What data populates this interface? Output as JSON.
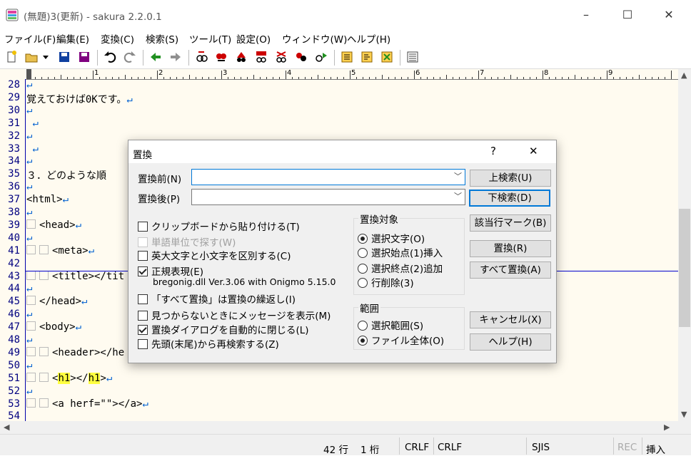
{
  "window": {
    "title": "(無題)3(更新) - sakura 2.2.0.1",
    "minimize": "–",
    "maximize": "☐",
    "close": "✕"
  },
  "menu": [
    "ファイル(F)",
    "編集(E)",
    "変換(C)",
    "検索(S)",
    "ツール(T)",
    "設定(O)",
    "ウィンドウ(W)",
    "ヘルプ(H)"
  ],
  "toolbar_icons": [
    "new-file-icon",
    "open-folder-icon",
    "dropdown-icon",
    "save-icon",
    "save-all-icon",
    "undo-icon",
    "redo-icon",
    "jump-back-icon",
    "jump-forward-icon",
    "search-prev-icon",
    "search-next-icon",
    "search-mark-icon",
    "replace-icon",
    "clear-mark-icon",
    "grep-icon",
    "compare-icon",
    "outline-icon",
    "function-list-icon",
    "bookmark-icon",
    "settings-icon"
  ],
  "ruler": {
    "marks": [
      "1",
      "2",
      "3",
      "4",
      "5",
      "6",
      "7",
      "8",
      "9"
    ]
  },
  "editor": {
    "lines": [
      {
        "n": "28",
        "text": "",
        "ret": "↵"
      },
      {
        "n": "29",
        "text": "覚えておけば0Kです。",
        "ret": "↵"
      },
      {
        "n": "30",
        "text": "",
        "ret": "↵"
      },
      {
        "n": "31",
        "text": " ",
        "ret": "↵"
      },
      {
        "n": "32",
        "text": "",
        "ret": "↵"
      },
      {
        "n": "33",
        "text": " ",
        "ret": "↵"
      },
      {
        "n": "34",
        "text": "",
        "ret": "↵"
      },
      {
        "n": "35",
        "text": "３．どのような順",
        "ret": ""
      },
      {
        "n": "36",
        "text": "",
        "ret": "↵"
      },
      {
        "n": "37",
        "text": "<html>",
        "ret": "↵"
      },
      {
        "n": "38",
        "text": "",
        "ret": "↵"
      },
      {
        "n": "39",
        "text": "<head>",
        "tabs": 1,
        "ret": "↵"
      },
      {
        "n": "40",
        "text": "",
        "ret": "↵"
      },
      {
        "n": "41",
        "text": "<meta>",
        "tabs": 2,
        "ret": "↵"
      },
      {
        "n": "42",
        "text": "",
        "ret": ""
      },
      {
        "n": "43",
        "text": "<title></tit",
        "tabs": 2,
        "ret": ""
      },
      {
        "n": "44",
        "text": "",
        "ret": "↵"
      },
      {
        "n": "45",
        "text": "</head>",
        "tabs": 1,
        "ret": "↵"
      },
      {
        "n": "46",
        "text": "",
        "ret": "↵"
      },
      {
        "n": "47",
        "text": "<body>",
        "tabs": 1,
        "ret": "↵"
      },
      {
        "n": "48",
        "text": "",
        "ret": "↵"
      },
      {
        "n": "49",
        "text": "<header></he",
        "tabs": 2,
        "ret": ""
      },
      {
        "n": "50",
        "text": "",
        "ret": "↵"
      },
      {
        "n": "51",
        "text": "",
        "tabs": 2,
        "ret": "↵",
        "h1": true
      },
      {
        "n": "52",
        "text": "",
        "ret": "↵"
      },
      {
        "n": "53",
        "text": "<a herf=\"\"></a>",
        "tabs": 2,
        "ret": "↵"
      },
      {
        "n": "54",
        "text": "",
        "ret": ""
      }
    ],
    "h1_open": "<",
    "h1_tag": "h1",
    "h1_mid": "></",
    "h1_close": ">"
  },
  "status": {
    "line": "42 行",
    "col": "1 桁",
    "eol1": "CRLF",
    "eol2": "CRLF",
    "encoding": "SJIS",
    "rec": "REC",
    "mode": "挿入"
  },
  "dialog": {
    "title": "置換",
    "help_icon": "?",
    "close_icon": "✕",
    "find_label": "置換前(N)",
    "replace_label": "置換後(P)",
    "find_value": "",
    "replace_value": "",
    "buttons": {
      "search_up": "上検索(U)",
      "search_down": "下検索(D)",
      "mark_lines": "該当行マーク(B)",
      "replace": "置換(R)",
      "replace_all": "すべて置換(A)",
      "cancel": "キャンセル(X)",
      "help": "ヘルプ(H)"
    },
    "options": [
      {
        "label": "クリップボードから貼り付ける(T)",
        "checked": false,
        "disabled": false
      },
      {
        "label": "単語単位で探す(W)",
        "checked": false,
        "disabled": true
      },
      {
        "label": "英大文字と小文字を区別する(C)",
        "checked": false,
        "disabled": false
      },
      {
        "label": "正規表現(E)",
        "checked": true,
        "disabled": false
      }
    ],
    "regex_lib": "bregonig.dll Ver.3.06 with Onigmo 5.15.0",
    "options2": [
      {
        "label": "「すべて置換」は置換の繰返し(I)",
        "checked": false
      },
      {
        "label": "見つからないときにメッセージを表示(M)",
        "checked": false
      },
      {
        "label": "置換ダイアログを自動的に閉じる(L)",
        "checked": true
      },
      {
        "label": "先頭(末尾)から再検索する(Z)",
        "checked": false
      }
    ],
    "target_group": {
      "title": "置換対象",
      "items": [
        {
          "label": "選択文字(O)",
          "selected": true
        },
        {
          "label": "選択始点(1)挿入",
          "selected": false
        },
        {
          "label": "選択終点(2)追加",
          "selected": false
        },
        {
          "label": "行削除(3)",
          "selected": false
        }
      ]
    },
    "range_group": {
      "title": "範囲",
      "items": [
        {
          "label": "選択範囲(S)",
          "selected": false
        },
        {
          "label": "ファイル全体(O)",
          "selected": true
        }
      ]
    }
  }
}
